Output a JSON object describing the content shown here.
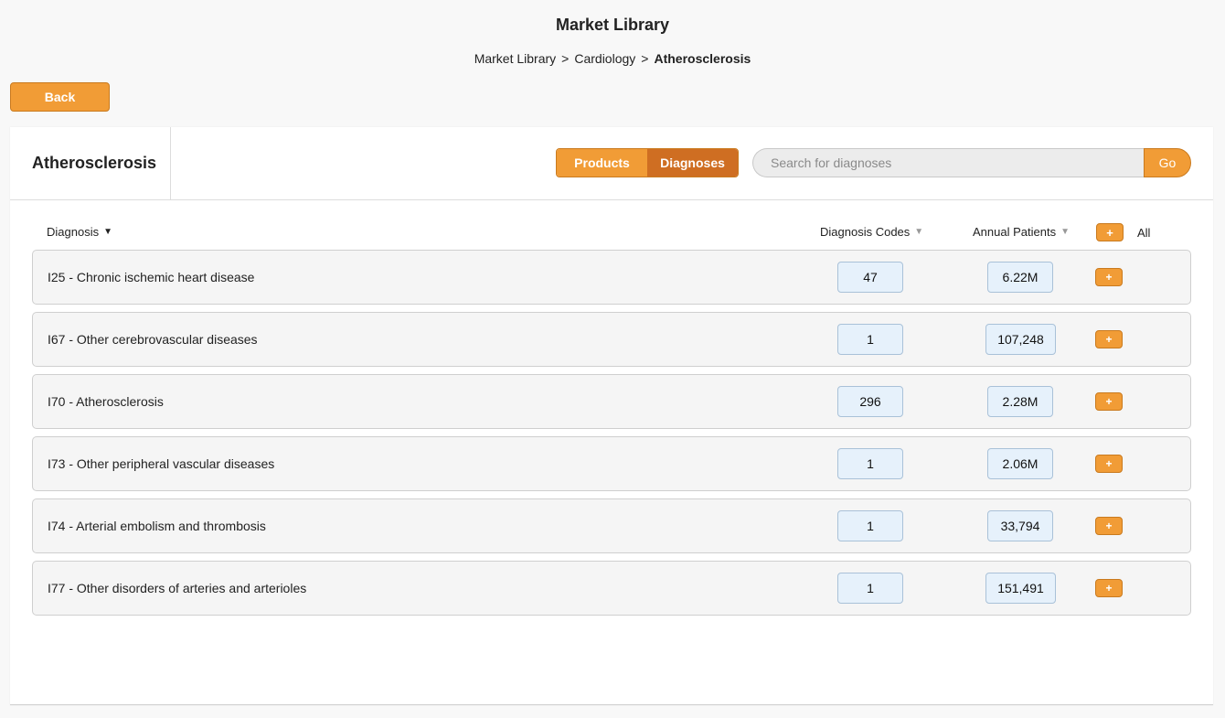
{
  "page": {
    "title": "Market Library"
  },
  "breadcrumb": {
    "items": [
      "Market Library",
      "Cardiology",
      "Atherosclerosis"
    ],
    "separator": ">"
  },
  "back_label": "Back",
  "panel": {
    "title": "Atherosclerosis",
    "tabs": [
      {
        "label": "Products",
        "active": false
      },
      {
        "label": "Diagnoses",
        "active": true
      }
    ],
    "search": {
      "placeholder": "Search for diagnoses",
      "value": "",
      "go_label": "Go"
    }
  },
  "table": {
    "headers": {
      "diagnosis": "Diagnosis",
      "codes": "Diagnosis Codes",
      "patients": "Annual Patients",
      "all": "All",
      "add_all": "+"
    },
    "rows": [
      {
        "label": "I25 - Chronic ischemic heart disease",
        "codes": "47",
        "patients": "6.22M",
        "add": "+"
      },
      {
        "label": "I67 - Other cerebrovascular diseases",
        "codes": "1",
        "patients": "107,248",
        "add": "+"
      },
      {
        "label": "I70 - Atherosclerosis",
        "codes": "296",
        "patients": "2.28M",
        "add": "+"
      },
      {
        "label": "I73 - Other peripheral vascular diseases",
        "codes": "1",
        "patients": "2.06M",
        "add": "+"
      },
      {
        "label": "I74 - Arterial embolism and thrombosis",
        "codes": "1",
        "patients": "33,794",
        "add": "+"
      },
      {
        "label": "I77 - Other disorders of arteries and arterioles",
        "codes": "1",
        "patients": "151,491",
        "add": "+"
      }
    ]
  },
  "colors": {
    "accent": "#f19c36",
    "accent_active": "#cf6e22",
    "pill_bg": "#e6f1fb"
  }
}
